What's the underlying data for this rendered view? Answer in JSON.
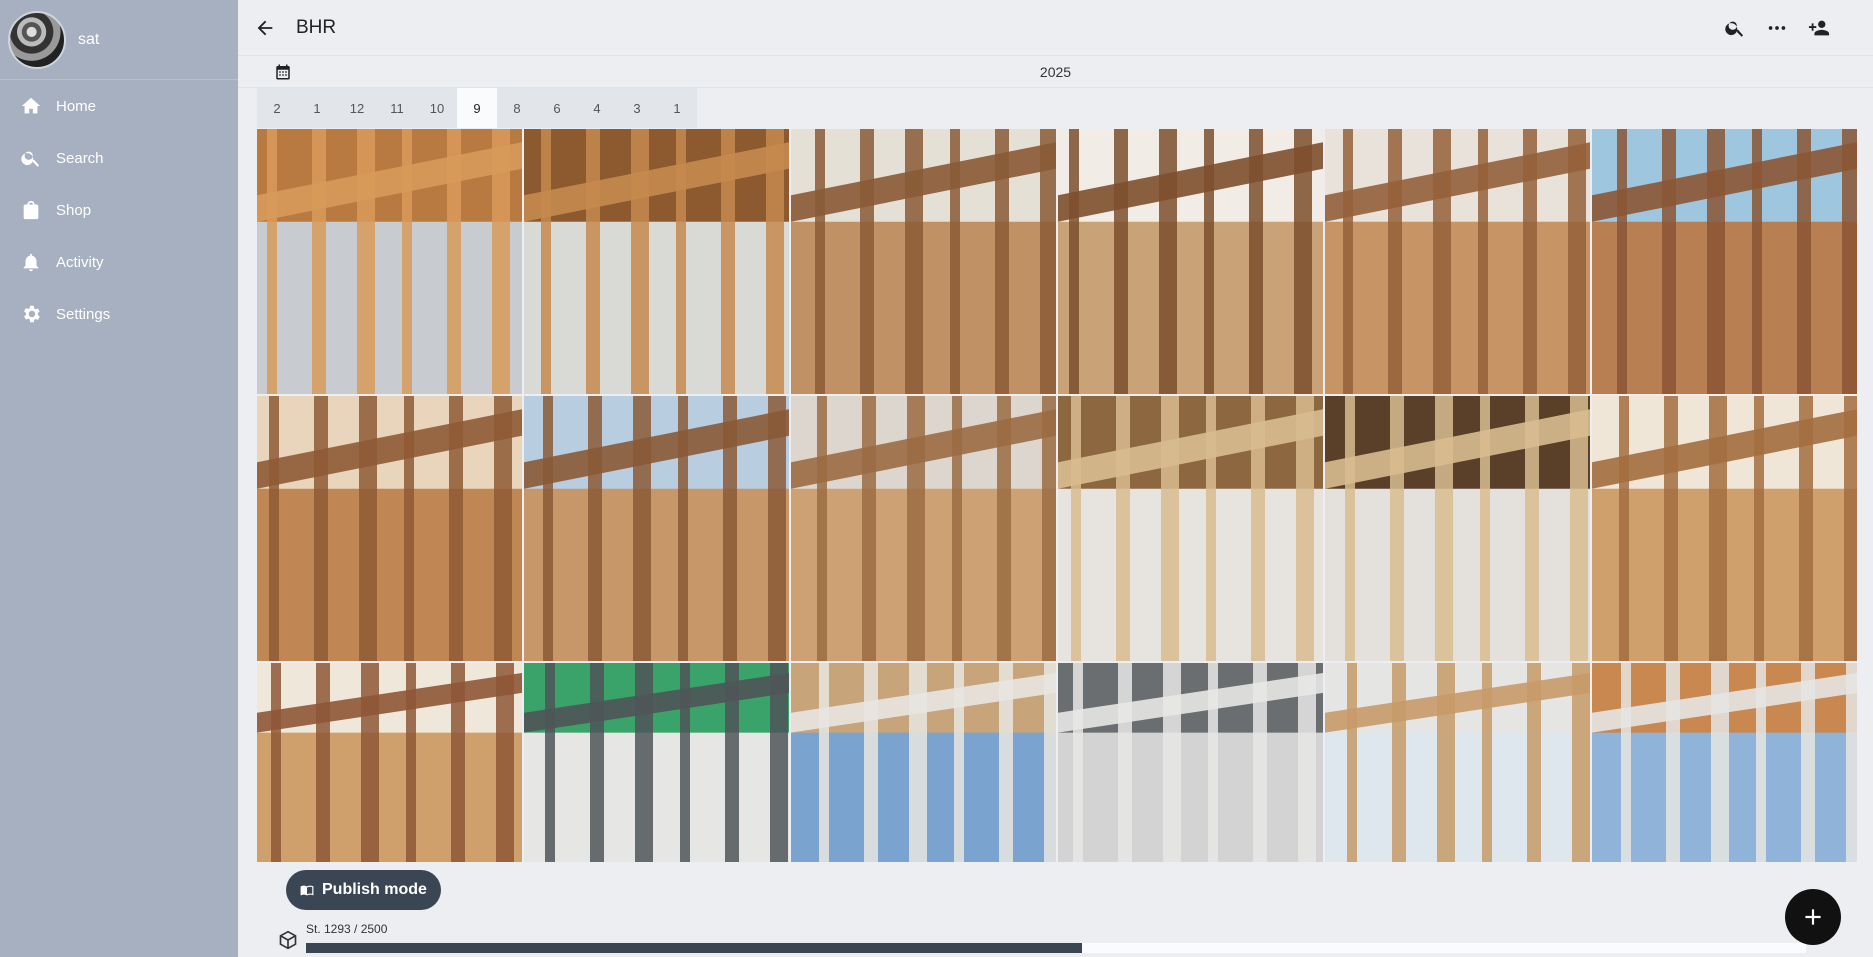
{
  "sidebar": {
    "username": "sat",
    "items": [
      {
        "label": "Home",
        "icon": "home-icon"
      },
      {
        "label": "Search",
        "icon": "search-icon"
      },
      {
        "label": "Shop",
        "icon": "shopping-bag-icon"
      },
      {
        "label": "Activity",
        "icon": "bell-icon"
      },
      {
        "label": "Settings",
        "icon": "gear-icon"
      }
    ]
  },
  "header": {
    "title": "BHR"
  },
  "timeline": {
    "year": "2025",
    "months": [
      "2",
      "1",
      "12",
      "11",
      "10",
      "9",
      "8",
      "6",
      "4",
      "3",
      "1"
    ],
    "active_month": "9"
  },
  "photos": [
    {
      "scene": "insulation-board"
    },
    {
      "scene": "floor-framing"
    },
    {
      "scene": "roof-beams-window"
    },
    {
      "scene": "worker-ceiling"
    },
    {
      "scene": "ladder-room"
    },
    {
      "scene": "ceiling-grid-window"
    },
    {
      "scene": "ceiling-grid-long"
    },
    {
      "scene": "room-window-floor"
    },
    {
      "scene": "plywood-wall"
    },
    {
      "scene": "roof-truss"
    },
    {
      "scene": "truss-glove"
    },
    {
      "scene": "wall-studs"
    },
    {
      "scene": "wall-studs-2"
    },
    {
      "scene": "wrap-window"
    },
    {
      "scene": "eave-sky"
    },
    {
      "scene": "scaffold-wrap"
    },
    {
      "scene": "eave-corner"
    },
    {
      "scene": "house-wrap-roof"
    }
  ],
  "publish": {
    "label": "Publish mode"
  },
  "storage": {
    "text": "St. 1293 / 2500",
    "used": 1293,
    "total": 2500
  },
  "colors": {
    "sidebar": "#a7b0c0",
    "accent": "#3b4654"
  }
}
